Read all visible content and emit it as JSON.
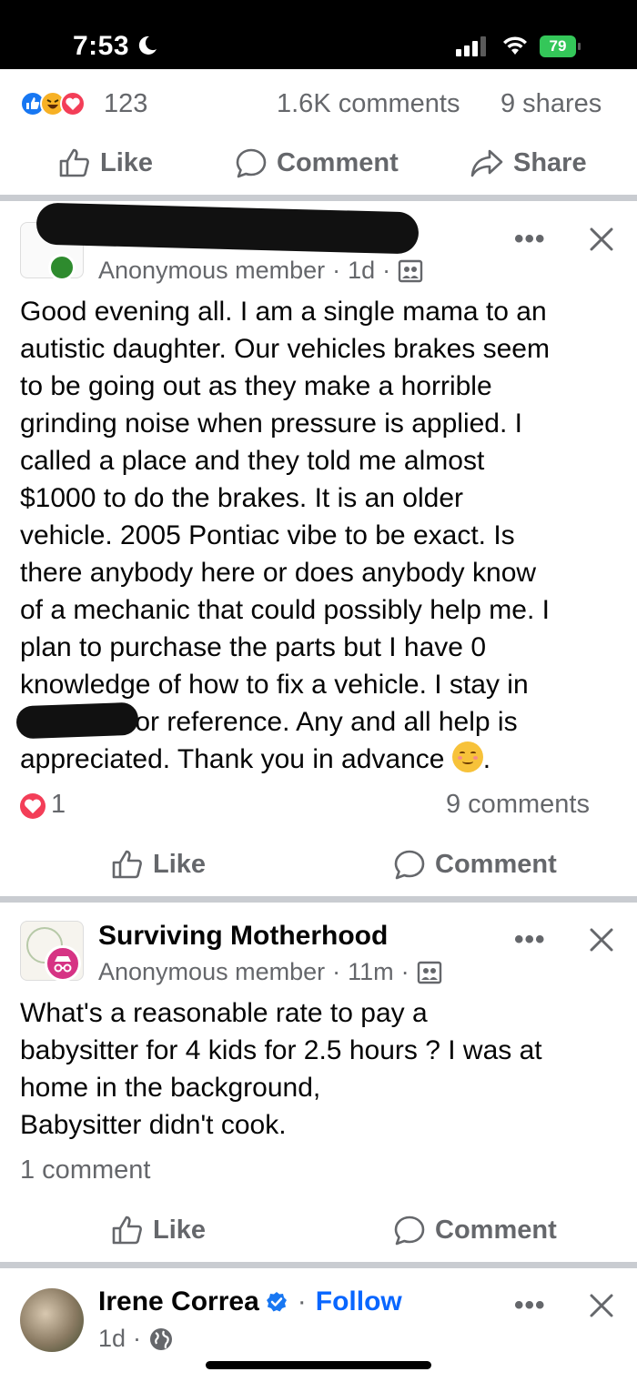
{
  "status_bar": {
    "time": "7:53",
    "battery": "79"
  },
  "top_post_footer": {
    "reaction_count": "123",
    "comments": "1.6K comments",
    "shares": "9 shares",
    "like_label": "Like",
    "comment_label": "Comment",
    "share_label": "Share"
  },
  "post_1": {
    "author": "Anonymous member",
    "time": "1d",
    "body_lines": [
      "Good evening all. I am a single mama to an",
      "autistic daughter. Our vehicles brakes seem",
      "to be going out as they make a horrible",
      "grinding noise when pressure is applied. I",
      "called a place and they told me almost",
      "$1000 to do the brakes. It is an older",
      "vehicle. 2005 Pontiac vibe to be exact. Is",
      "there anybody here or does anybody know",
      "of a mechanic that could possibly help me. I",
      "plan to purchase the parts but I have 0",
      "knowledge of how to fix a vehicle.  I stay in",
      "for reference. Any and all help is",
      "appreciated. Thank you in advance"
    ],
    "reaction_count": "1",
    "comments": "9 comments",
    "like_label": "Like",
    "comment_label": "Comment"
  },
  "post_2": {
    "group": "Surviving Motherhood",
    "author": "Anonymous member",
    "time": "11m",
    "body_lines": [
      "What's a reasonable rate to pay a",
      "babysitter for 4 kids for 2.5 hours ? I was at",
      "home in the background,",
      "Babysitter didn't cook."
    ],
    "comments": "1 comment",
    "like_label": "Like",
    "comment_label": "Comment"
  },
  "post_3": {
    "author": "Irene Correa",
    "follow_label": "Follow",
    "time": "1d"
  },
  "colors": {
    "like_blue": "#1877f2",
    "love_red": "#f33e58",
    "follow_blue": "#0866ff",
    "divider": "#c9ccd1",
    "secondary_text": "#65676b"
  }
}
